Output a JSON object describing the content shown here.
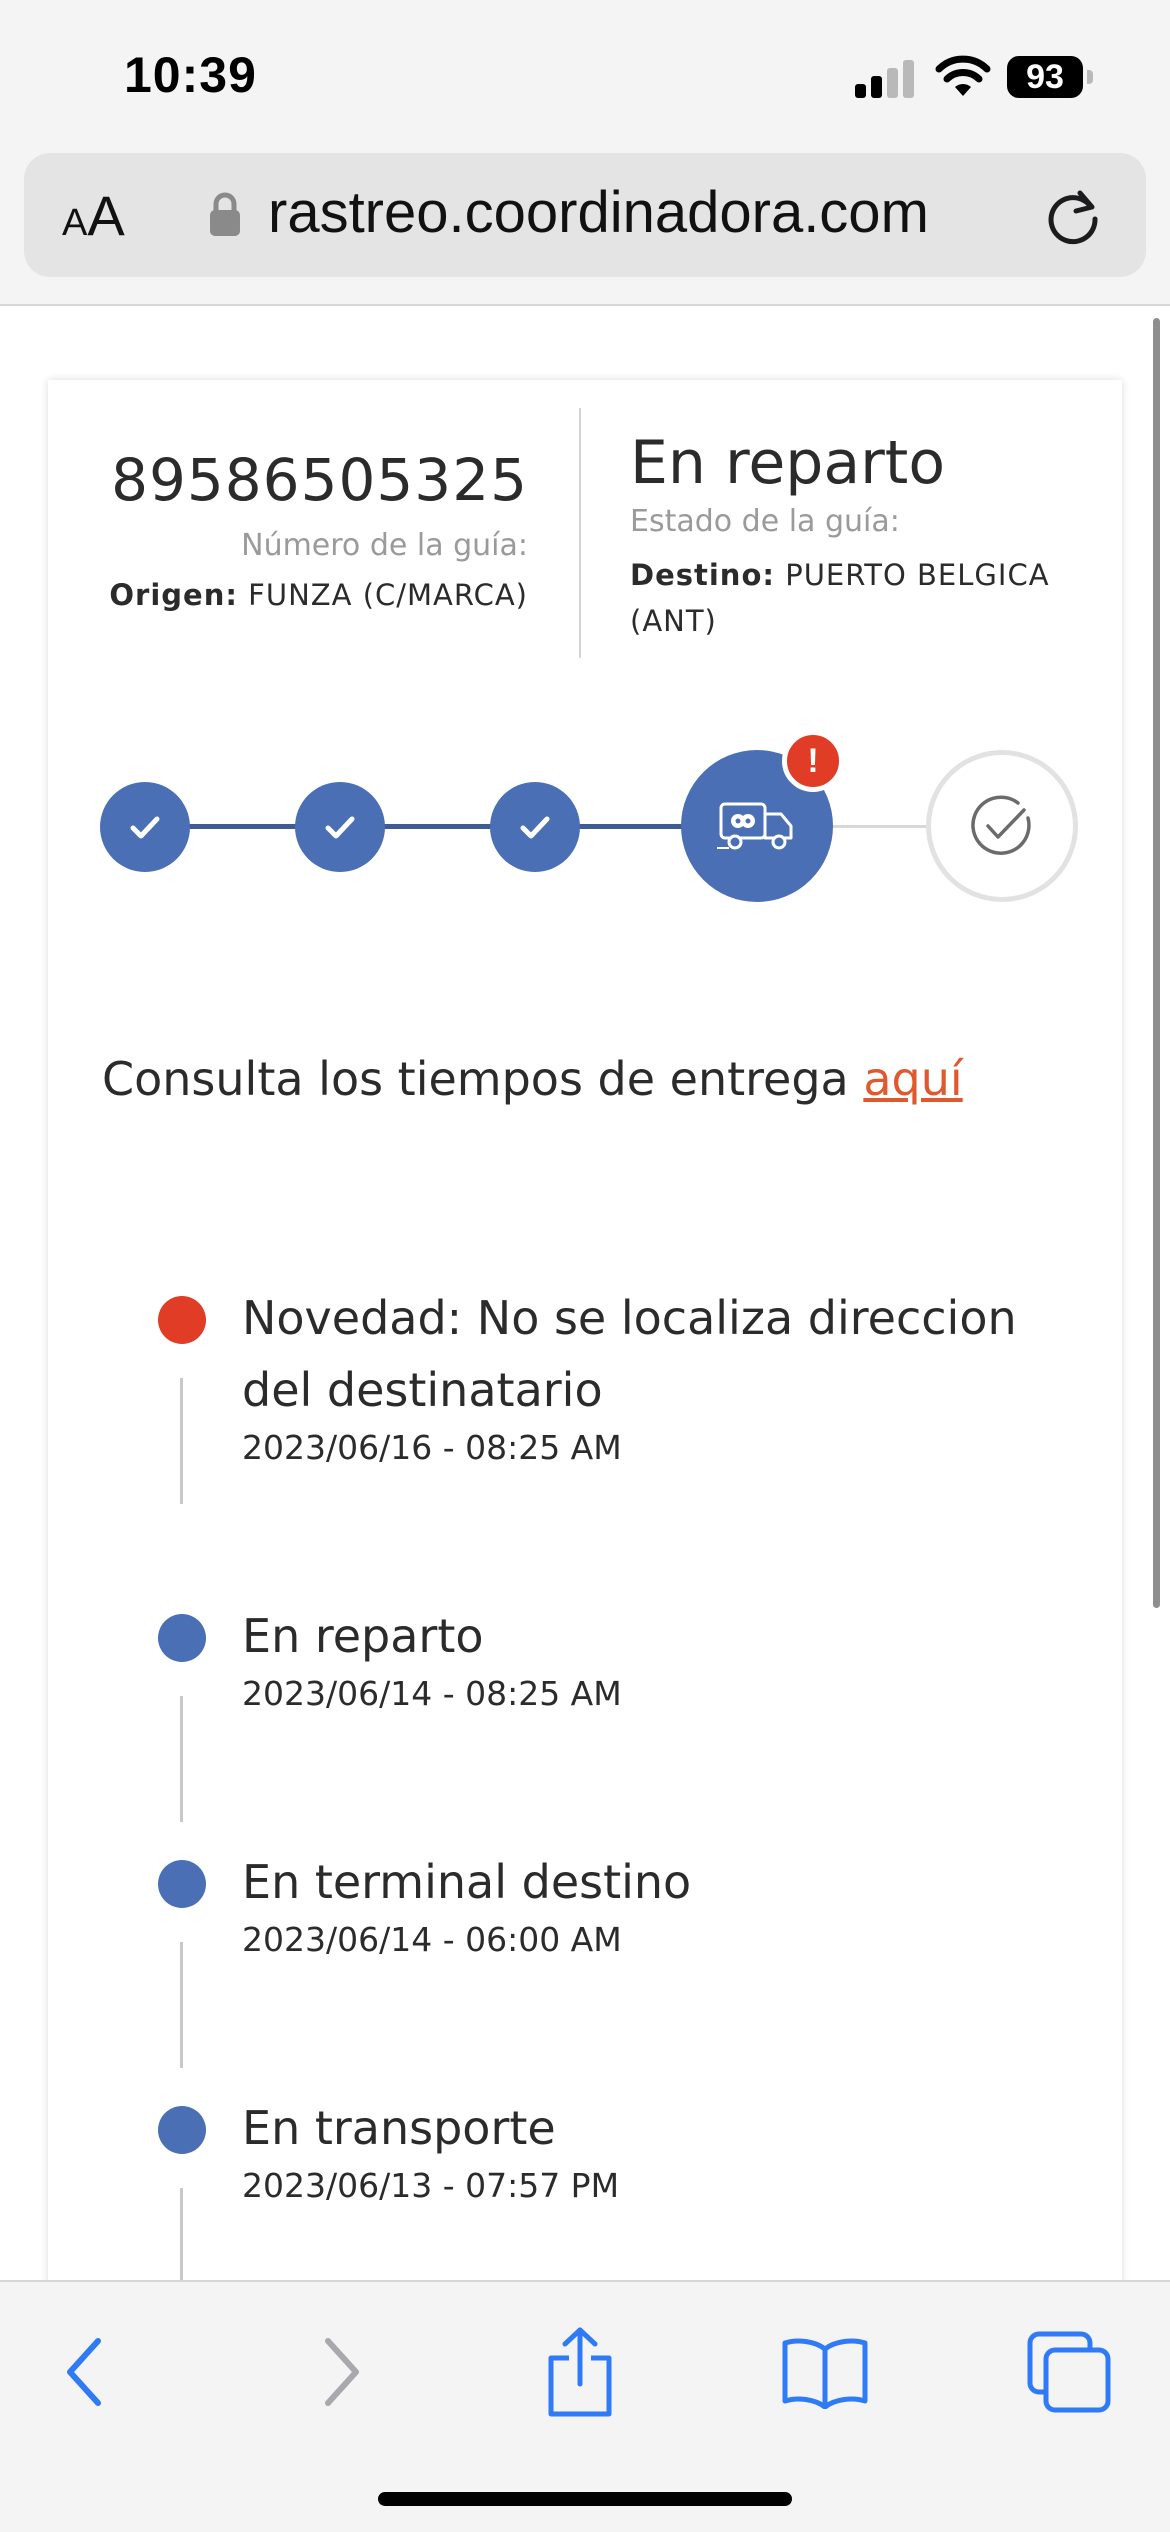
{
  "status_bar": {
    "time": "10:39",
    "battery": "93",
    "icons": [
      "cellular-signal-icon",
      "wifi-icon",
      "battery-icon"
    ]
  },
  "browser": {
    "text_size_small": "A",
    "text_size_big": "A",
    "url": "rastreo.coordinadora.com",
    "icons": [
      "lock-icon",
      "reload-icon"
    ]
  },
  "shipment": {
    "guide_number": "89586505325",
    "guide_number_label": "Número de la guía:",
    "origin_label": "Origen:",
    "origin_value": "FUNZA (C/MARCA)",
    "status_value": "En reparto",
    "status_label": "Estado de la guía:",
    "destination_label": "Destino:",
    "destination_value": "PUERTO BELGICA (ANT)"
  },
  "tracker": {
    "alert_badge": "!",
    "steps": [
      "completed",
      "completed",
      "completed",
      "current",
      "pending"
    ],
    "icons": [
      "check-icon",
      "check-icon",
      "check-icon",
      "delivery-truck-icon",
      "delivered-check-icon"
    ]
  },
  "delivery_times": {
    "text": "Consulta los tiempos de entrega ",
    "link": "aquí"
  },
  "timeline": [
    {
      "title": "Novedad: No se localiza direccion del destinatario",
      "date": "2023/06/16 - 08:25 AM",
      "type": "alert"
    },
    {
      "title": "En reparto",
      "date": "2023/06/14 - 08:25 AM",
      "type": "normal"
    },
    {
      "title": "En terminal destino",
      "date": "2023/06/14 - 06:00 AM",
      "type": "normal"
    },
    {
      "title": "En transporte",
      "date": "2023/06/13 - 07:57 PM",
      "type": "normal"
    }
  ],
  "toolbar": {
    "icons": [
      "back-icon",
      "forward-icon",
      "share-icon",
      "bookmarks-icon",
      "tabs-icon"
    ]
  },
  "colors": {
    "accent": "#4a6fb5",
    "alert": "#e03c26",
    "link": "#e0592e",
    "browser_blue": "#2f7bf5"
  }
}
